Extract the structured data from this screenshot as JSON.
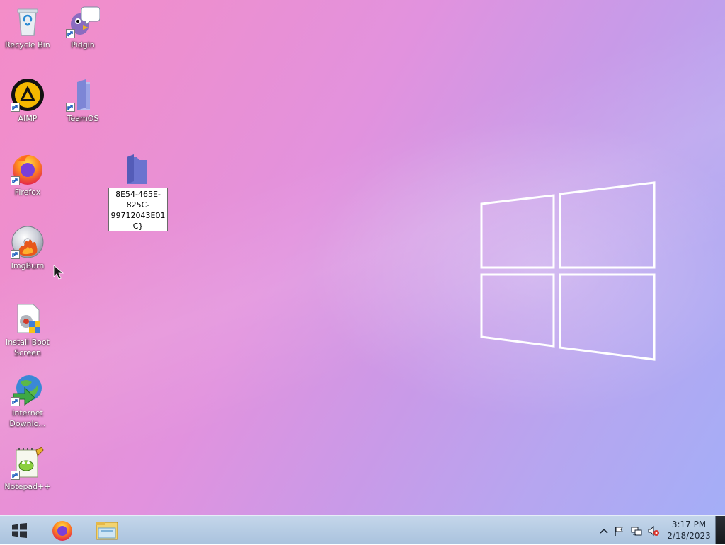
{
  "desktop": {
    "icons": [
      {
        "label": "Recycle Bin"
      },
      {
        "label": "Pidgin"
      },
      {
        "label": "AIMP"
      },
      {
        "label": "TeamOS"
      },
      {
        "label": "Firefox"
      },
      {
        "label": "ImgBurn"
      },
      {
        "label": "Install Boot Screen"
      },
      {
        "label": "Internet Downlo..."
      },
      {
        "label": "Notepad++"
      }
    ],
    "rename_field": {
      "value": "8E54-465E-825C-99712043E01C}"
    }
  },
  "taskbar": {
    "pinned": [
      {
        "icon": "firefox-icon"
      },
      {
        "icon": "file-explorer-icon"
      }
    ],
    "tray": {
      "time": "3:17 PM",
      "date": "2/18/2023",
      "icons": [
        "show-hidden-icons-icon",
        "action-center-flag-icon",
        "network-icon",
        "volume-muted-icon"
      ]
    }
  },
  "colors": {
    "wallpaper_start": "#f48cc8",
    "wallpaper_end": "#a4aef7",
    "taskbar": "#b8cce3"
  }
}
